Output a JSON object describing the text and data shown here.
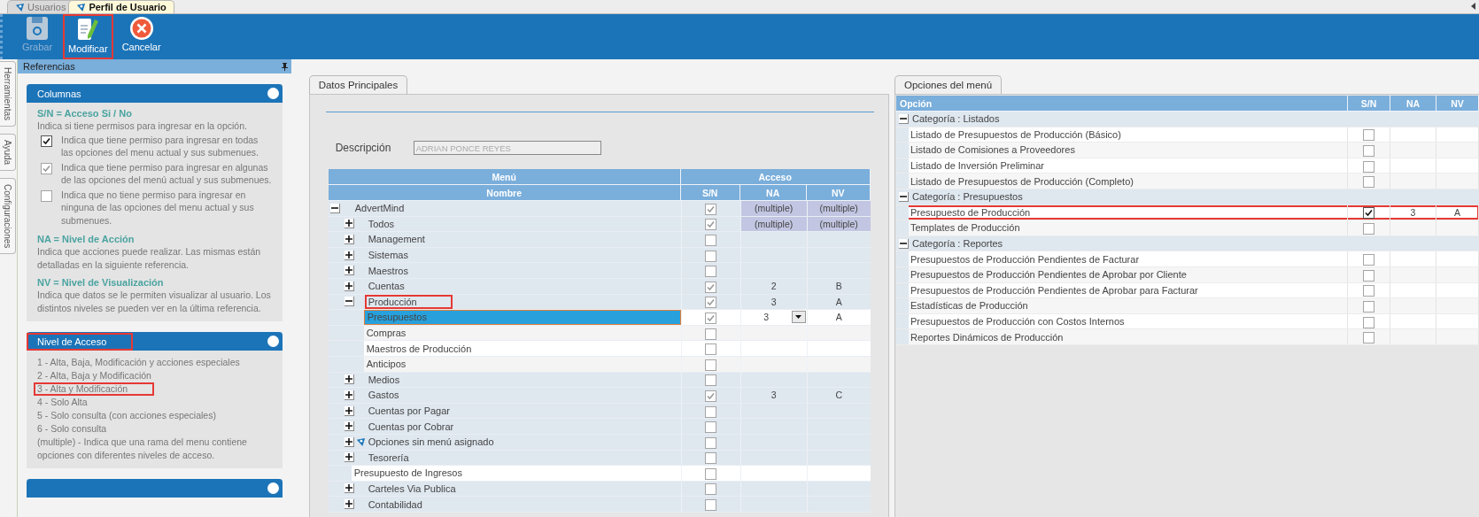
{
  "doc_tabs": [
    {
      "label": "Usuarios",
      "selected": false
    },
    {
      "label": "Perfil de Usuario",
      "selected": true
    }
  ],
  "toolbar": [
    {
      "label": "Grabar",
      "kind": "save",
      "disabled": true,
      "highlighted": false
    },
    {
      "label": "Modificar",
      "kind": "edit",
      "disabled": false,
      "highlighted": true
    },
    {
      "label": "Cancelar",
      "kind": "cancel",
      "disabled": false,
      "highlighted": false
    }
  ],
  "side_tabs": [
    {
      "label": "Herramientas"
    },
    {
      "label": "Ayuda"
    },
    {
      "label": "Configuraciones"
    }
  ],
  "references": {
    "title": "Referencias",
    "cards": [
      {
        "kind": "full",
        "title": "Columnas",
        "highlighted": false,
        "blocks": [
          {
            "kind": "heading",
            "text": "S/N = Acceso Si / No",
            "highlighted": false
          },
          {
            "kind": "text",
            "text": "Indica si tiene permisos para ingresar en la opción.",
            "highlighted": false
          },
          {
            "kind": "check",
            "checked": true,
            "dimmed": false,
            "text": "Indica que tiene permiso para ingresar en todas las opciones del menu actual y sus submenues.",
            "highlighted": false
          },
          {
            "kind": "check",
            "checked": true,
            "dimmed": true,
            "text": "Indica que tiene permiso para ingresar en algunas de las opciones del menú actual y sus submenues.",
            "highlighted": false
          },
          {
            "kind": "check",
            "checked": false,
            "text": "Indica que no tiene permiso para ingresar en ninguna de las opciones del menu actual y sus submenues.",
            "highlighted": false
          },
          {
            "kind": "heading",
            "text": "NA = Nivel de Acción",
            "highlighted": false
          },
          {
            "kind": "text",
            "text": "Indica que acciones puede realizar. Las mismas están detalladas en la siguiente referencia.",
            "highlighted": false
          },
          {
            "kind": "heading",
            "text": "NV = Nivel de Visualización",
            "highlighted": false
          },
          {
            "kind": "text",
            "text": "Indica que datos se le permiten visualizar al usuario. Los distintos niveles se pueden ver en la última referencia.",
            "highlighted": false
          }
        ]
      },
      {
        "kind": "full",
        "title": "Nivel de Acceso",
        "highlighted": true,
        "blocks": [
          {
            "kind": "line",
            "text": "1 - Alta, Baja, Modificación y acciones especiales",
            "highlighted": false
          },
          {
            "kind": "line",
            "text": "2 - Alta, Baja y Modificación",
            "highlighted": false
          },
          {
            "kind": "line",
            "text": "3 - Alta y Modificación",
            "highlighted": true
          },
          {
            "kind": "line",
            "text": "4 - Solo Alta",
            "highlighted": false
          },
          {
            "kind": "line",
            "text": "5 - Solo consulta (con acciones especiales)",
            "highlighted": false
          },
          {
            "kind": "line",
            "text": "6 - Solo consulta",
            "highlighted": false
          },
          {
            "kind": "text",
            "text": "(multiple) - Indica que una rama del menu contiene opciones con diferentes niveles de acceso.",
            "highlighted": false
          }
        ]
      },
      {
        "kind": "cut",
        "highlighted": false
      }
    ]
  },
  "main_tab": {
    "label": "Datos Principales",
    "selected": true
  },
  "description": {
    "label": "Descripción",
    "value": "ADRIAN PONCE REYES"
  },
  "menu_table": {
    "group_headers": [
      "Menú",
      "Acceso"
    ],
    "columns": [
      "Nombre",
      "S/N",
      "NA",
      "NV"
    ],
    "rows": [
      {
        "name": "AdvertMind",
        "kind": "menu",
        "expandable": true,
        "expanded": true,
        "checked": true,
        "dimmed": true,
        "mixed": true,
        "selected": false,
        "highlighted": false,
        "na": "(multiple)",
        "nv": "(multiple)",
        "children": [
          {
            "name": "Todos",
            "kind": "menu",
            "expandable": true,
            "checked": true,
            "dimmed": true,
            "mixed": true,
            "selected": false,
            "highlighted": false,
            "na": "(multiple)",
            "nv": "(multiple)"
          },
          {
            "name": "Management",
            "kind": "menu",
            "expandable": true,
            "checked": false,
            "selected": false,
            "highlighted": false
          },
          {
            "name": "Sistemas",
            "kind": "menu",
            "expandable": true,
            "checked": false,
            "selected": false,
            "highlighted": false
          },
          {
            "name": "Maestros",
            "kind": "menu",
            "expandable": true,
            "checked": false,
            "selected": false,
            "highlighted": false
          },
          {
            "name": "Cuentas",
            "kind": "menu",
            "expandable": true,
            "checked": true,
            "dimmed": true,
            "mixed": false,
            "selected": false,
            "highlighted": false,
            "na": "2",
            "nv": "B"
          },
          {
            "name": "Producción",
            "kind": "menu",
            "expandable": true,
            "expanded": true,
            "checked": true,
            "dimmed": true,
            "mixed": false,
            "selected": false,
            "highlighted": true,
            "na": "3",
            "nv": "A",
            "children": [
              {
                "name": "Presupuestos",
                "kind": "menu",
                "expandable": false,
                "checked": true,
                "dimmed": true,
                "mixed": false,
                "selected": true,
                "highlighted": false,
                "na": "3",
                "nv": "A"
              },
              {
                "name": "Compras",
                "kind": "menu",
                "expandable": false,
                "checked": false,
                "selected": false,
                "highlighted": false
              },
              {
                "name": "Maestros de Producción",
                "kind": "menu",
                "expandable": false,
                "checked": false,
                "selected": false,
                "highlighted": false
              },
              {
                "name": "Anticipos",
                "kind": "menu",
                "expandable": false,
                "checked": false,
                "selected": false,
                "highlighted": false
              }
            ]
          },
          {
            "name": "Medios",
            "kind": "menu",
            "expandable": true,
            "checked": false,
            "selected": false,
            "highlighted": false
          },
          {
            "name": "Gastos",
            "kind": "menu",
            "expandable": true,
            "checked": true,
            "dimmed": true,
            "mixed": false,
            "selected": false,
            "highlighted": false,
            "na": "3",
            "nv": "C"
          },
          {
            "name": "Cuentas por Pagar",
            "kind": "menu",
            "expandable": true,
            "checked": false,
            "selected": false,
            "highlighted": false
          },
          {
            "name": "Cuentas por Cobrar",
            "kind": "menu",
            "expandable": true,
            "checked": false,
            "selected": false,
            "highlighted": false
          },
          {
            "name": "Opciones sin menú asignado",
            "kind": "unassigned",
            "expandable": true,
            "checked": false,
            "selected": false,
            "highlighted": false
          },
          {
            "name": "Tesorería",
            "kind": "menu",
            "expandable": true,
            "checked": false,
            "selected": false,
            "highlighted": false
          },
          {
            "name": "Presupuesto de Ingresos",
            "kind": "menu",
            "expandable": false,
            "checked": false,
            "selected": false,
            "highlighted": false
          },
          {
            "name": "Carteles Via Publica",
            "kind": "menu",
            "expandable": true,
            "checked": false,
            "selected": false,
            "highlighted": false
          },
          {
            "name": "Contabilidad",
            "kind": "menu",
            "expandable": true,
            "checked": false,
            "selected": false,
            "highlighted": false
          }
        ]
      }
    ]
  },
  "options_tab": {
    "label": "Opciones del menú",
    "selected": true
  },
  "options_table": {
    "columns": [
      "Opción",
      "S/N",
      "NA",
      "NV"
    ],
    "categories": [
      {
        "name": "Categoría : Listados",
        "expanded": true,
        "options": [
          {
            "name": "Listado de Presupuestos de Producción (Básico)",
            "checked": false,
            "highlighted": false
          },
          {
            "name": "Listado de Comisiones a Proveedores",
            "checked": false,
            "highlighted": false
          },
          {
            "name": "Listado de Inversión Preliminar",
            "checked": false,
            "highlighted": false
          },
          {
            "name": "Listado de Presupuestos de Producción (Completo)",
            "checked": false,
            "highlighted": false
          }
        ]
      },
      {
        "name": "Categoría : Presupuestos",
        "expanded": true,
        "options": [
          {
            "name": "Presupuesto de Producción",
            "checked": true,
            "highlighted": true,
            "na": "3",
            "nv": "A"
          },
          {
            "name": "Templates de Producción",
            "checked": false,
            "highlighted": false
          }
        ]
      },
      {
        "name": "Categoría : Reportes",
        "expanded": true,
        "options": [
          {
            "name": "Presupuestos de Producción Pendientes de Facturar",
            "checked": false,
            "highlighted": false
          },
          {
            "name": "Presupuestos de Producción Pendientes de Aprobar por Cliente",
            "checked": false,
            "highlighted": false
          },
          {
            "name": "Presupuestos de Producción Pendientes de Aprobar para Facturar",
            "checked": false,
            "highlighted": false
          },
          {
            "name": "Estadísticas de Producción",
            "checked": false,
            "highlighted": false
          },
          {
            "name": "Presupuestos de Producción con Costos Internos",
            "checked": false,
            "highlighted": false
          },
          {
            "name": "Reportes Dinámicos de Producción",
            "checked": false,
            "highlighted": false
          }
        ]
      }
    ]
  }
}
